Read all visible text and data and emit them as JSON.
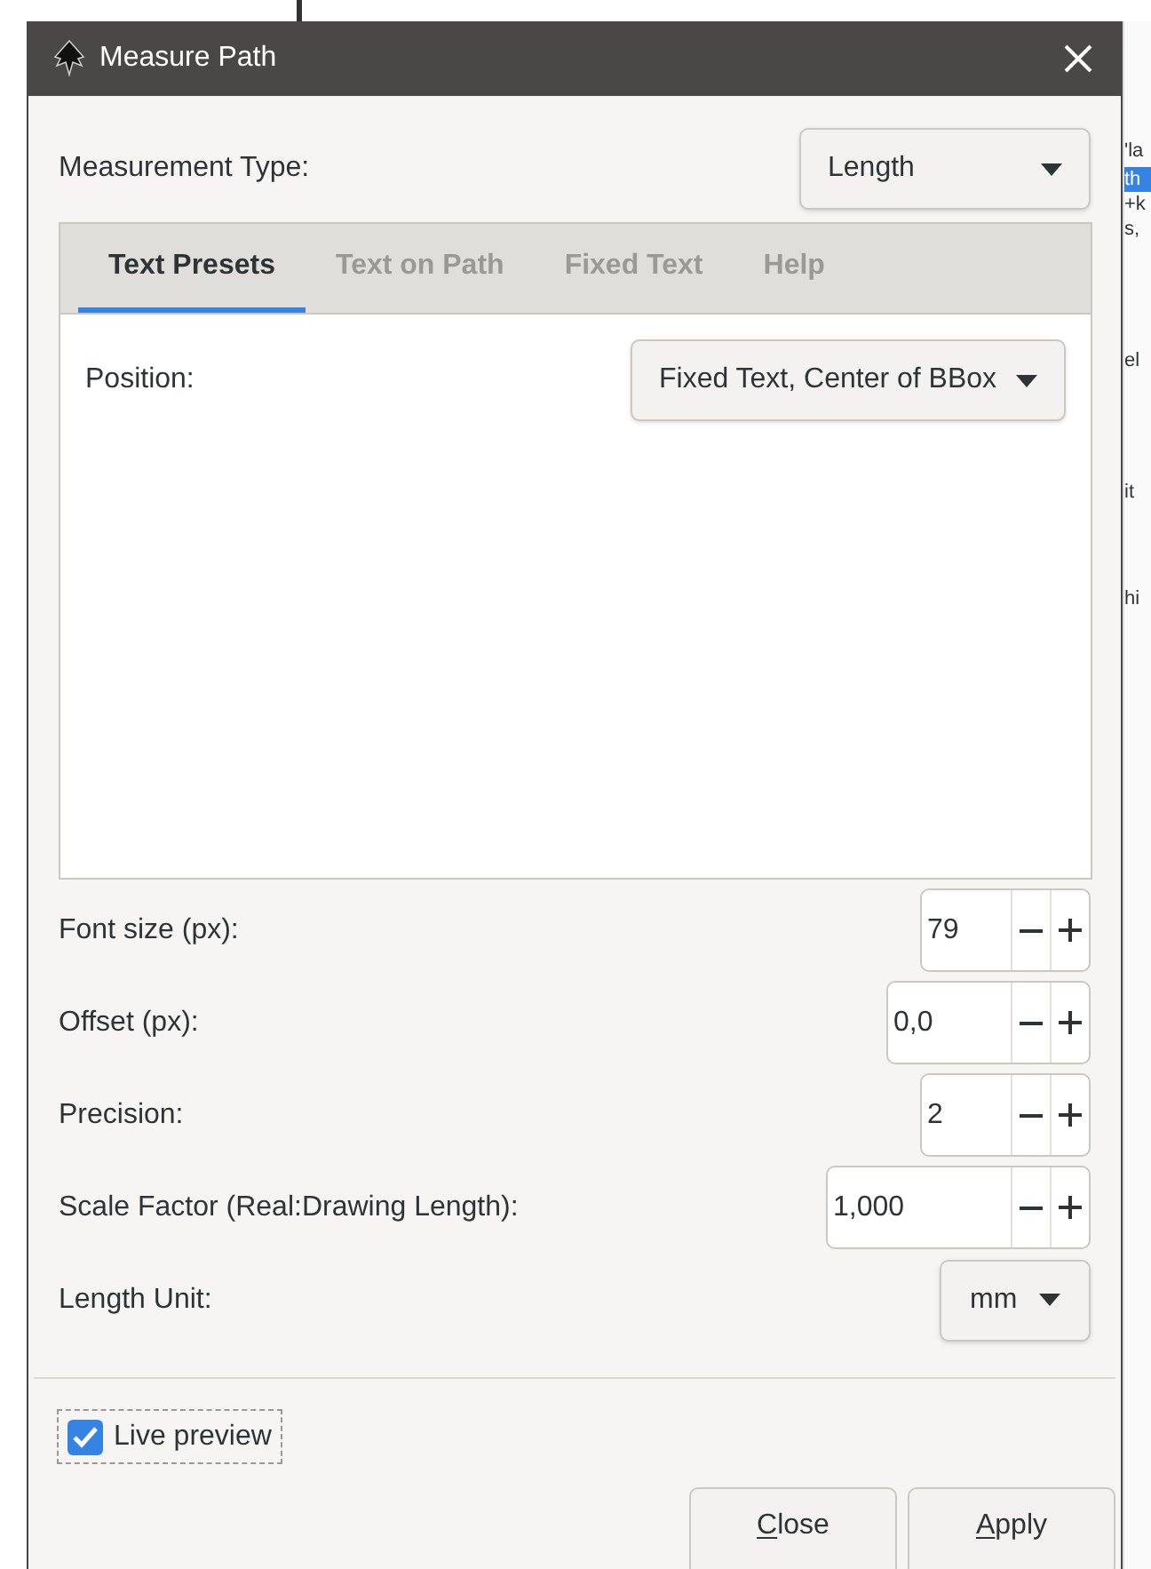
{
  "window": {
    "title": "Measure Path"
  },
  "measurement_type": {
    "label": "Measurement Type:",
    "value": "Length"
  },
  "tabs": [
    {
      "label": "Text Presets",
      "selected": true
    },
    {
      "label": "Text on Path",
      "selected": false
    },
    {
      "label": "Fixed Text",
      "selected": false
    },
    {
      "label": "Help",
      "selected": false
    }
  ],
  "position": {
    "label": "Position:",
    "value": "Fixed Text, Center of BBox"
  },
  "fields": [
    {
      "kind": "spin",
      "label": "Font size (px):",
      "value": "79"
    },
    {
      "kind": "spin",
      "label": "Offset (px):",
      "value": "0,0"
    },
    {
      "kind": "spin",
      "label": "Precision:",
      "value": "2"
    },
    {
      "kind": "spin",
      "label": "Scale Factor (Real:Drawing Length):",
      "value": "1,000"
    },
    {
      "kind": "dropdown",
      "label": "Length Unit:",
      "value": "mm"
    }
  ],
  "live_preview": {
    "label": "Live preview",
    "checked": true
  },
  "buttons": [
    {
      "label": "Close"
    },
    {
      "label": "Apply"
    }
  ],
  "background_fragments": [
    "'la",
    "th",
    "+k",
    "s,",
    "el",
    "it",
    "hi"
  ]
}
